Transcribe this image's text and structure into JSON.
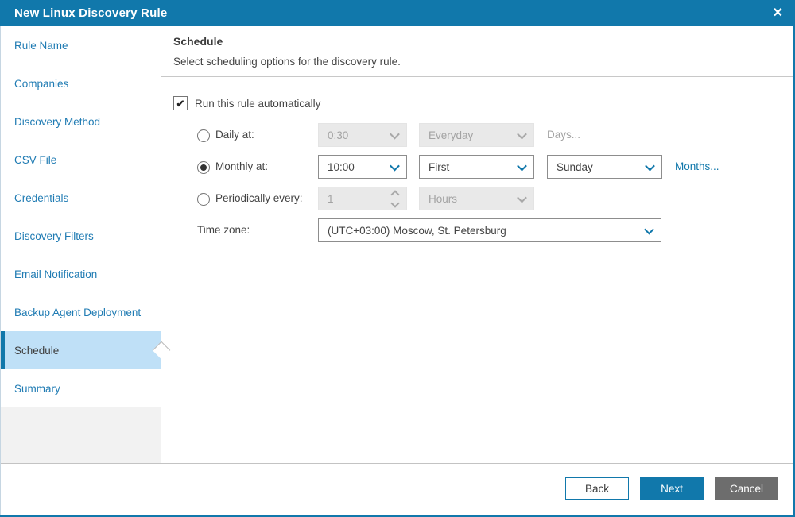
{
  "window": {
    "title": "New Linux Discovery Rule"
  },
  "icons": {
    "close": "✕",
    "check": "✔"
  },
  "sidebar": {
    "items": [
      {
        "label": "Rule Name",
        "selected": false
      },
      {
        "label": "Companies",
        "selected": false
      },
      {
        "label": "Discovery Method",
        "selected": false
      },
      {
        "label": "CSV File",
        "selected": false
      },
      {
        "label": "Credentials",
        "selected": false
      },
      {
        "label": "Discovery Filters",
        "selected": false
      },
      {
        "label": "Email Notification",
        "selected": false
      },
      {
        "label": "Backup Agent Deployment",
        "selected": false
      },
      {
        "label": "Schedule",
        "selected": true
      },
      {
        "label": "Summary",
        "selected": false
      }
    ]
  },
  "header": {
    "title": "Schedule",
    "subtitle": "Select scheduling options for the discovery rule."
  },
  "form": {
    "auto": {
      "label": "Run this rule automatically",
      "checked": true
    },
    "daily": {
      "label": "Daily at:",
      "selected": false,
      "enabled": false,
      "time": "0:30",
      "day": "Everyday",
      "link": "Days..."
    },
    "monthly": {
      "label": "Monthly at:",
      "selected": true,
      "enabled": true,
      "time": "10:00",
      "week": "First",
      "weekday": "Sunday",
      "link": "Months..."
    },
    "periodic": {
      "label": "Periodically every:",
      "selected": false,
      "enabled": false,
      "value": "1",
      "unit": "Hours"
    },
    "timezone": {
      "label": "Time zone:",
      "value": "(UTC+03:00) Moscow, St. Petersburg"
    }
  },
  "footer": {
    "back": "Back",
    "next": "Next",
    "cancel": "Cancel"
  },
  "colors": {
    "accent": "#1178ab",
    "selected_item_bg": "#bfe0f7",
    "sidebar_link": "#1f7bb3",
    "disabled_bg": "#e9e9e9",
    "disabled_text": "#a3a3a3",
    "cancel_button_bg": "#6d6d6d",
    "body_text": "#444444",
    "divider": "#c8c8c8"
  }
}
